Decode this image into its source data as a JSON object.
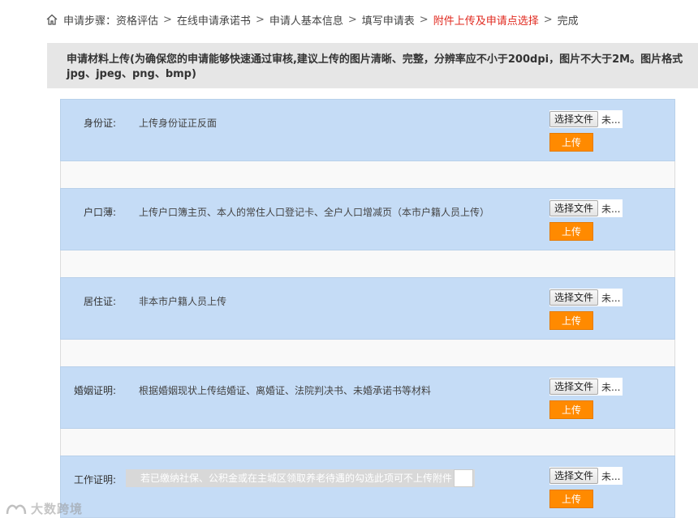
{
  "breadcrumb": {
    "steps": [
      "申请步骤：资格评估",
      "在线申请承诺书",
      "申请人基本信息",
      "填写申请表",
      "附件上传及申请点选择",
      "完成"
    ],
    "separator": ">",
    "active_index": 4,
    "active_color": "#e0281e"
  },
  "notice": {
    "text": "申请材料上传(为确保您的申请能够快速通过审核,建议上传的图片清晰、完整，分辨率应不小于200dpi，图片不大于2M。图片格式jpg、jpeg、png、bmp)"
  },
  "rows": [
    {
      "label": "身份证:",
      "description": "上传身份证正反面",
      "file_button": "选择文件",
      "file_status": "未...",
      "upload_button": "上传"
    },
    {
      "label": "户口薄:",
      "description": "上传户口簿主页、本人的常住人口登记卡、全户人口增减页（本市户籍人员上传）",
      "file_button": "选择文件",
      "file_status": "未...",
      "upload_button": "上传"
    },
    {
      "label": "居住证:",
      "description": "非本市户籍人员上传",
      "file_button": "选择文件",
      "file_status": "未...",
      "upload_button": "上传"
    },
    {
      "label": "婚姻证明:",
      "description": "根据婚姻现状上传结婚证、离婚证、法院判决书、未婚承诺书等材料",
      "file_button": "选择文件",
      "file_status": "未...",
      "upload_button": "上传"
    },
    {
      "label": "工作证明:",
      "description": "若已缴纳社保、公积金或在主城区领取养老待遇的勾选此项可不上传附件",
      "file_button": "选择文件",
      "file_status": "未...",
      "upload_button": "上传"
    }
  ],
  "colors": {
    "row_bg": "#c5dcf6",
    "upload_button": "#ff8a00",
    "notice_bg": "#e6e6e6"
  },
  "watermark": {
    "text": "大数跨境"
  }
}
